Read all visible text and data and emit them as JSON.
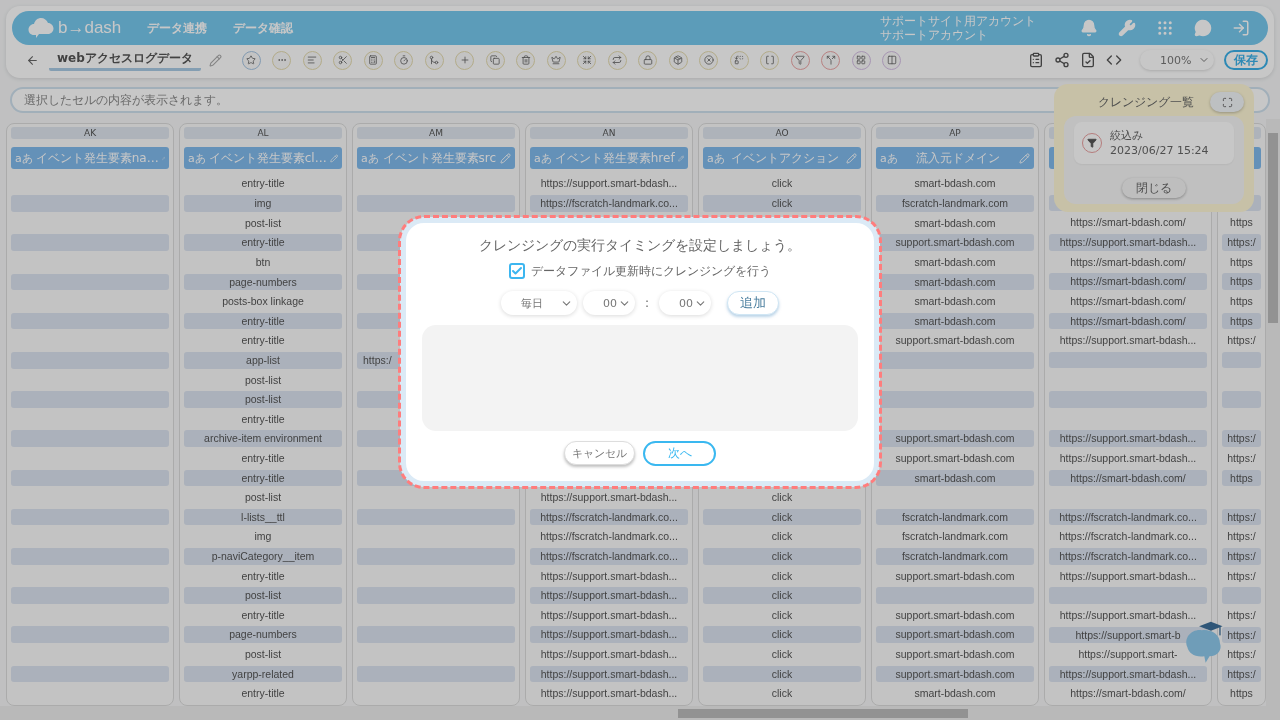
{
  "header": {
    "logo": "b→dash",
    "nav": [
      {
        "label": "データ連携"
      },
      {
        "label": "データ確認"
      }
    ],
    "account": [
      "サポートサイト用アカウント",
      "サポートアカウント"
    ]
  },
  "toolbar": {
    "title": "webアクセスログデータ",
    "zoom": "100%",
    "save": "保存"
  },
  "cell_display": {
    "placeholder": "選択したセルの内容が表示されます。"
  },
  "table": {
    "columns": [
      {
        "letter": "AK",
        "name": "イベント発生要素na…",
        "type_badge": "aあ",
        "cells": [
          null,
          null,
          null,
          null,
          null,
          null,
          null,
          null,
          null,
          null,
          null,
          null,
          null,
          null,
          null,
          null,
          null,
          null,
          null,
          null,
          null,
          null,
          null,
          null,
          null,
          null,
          null
        ]
      },
      {
        "letter": "AL",
        "name": "イベント発生要素cl…",
        "type_badge": "aあ",
        "cells": [
          "entry-title",
          "img",
          "post-list",
          "entry-title",
          "btn",
          "page-numbers",
          "posts-box linkage",
          "entry-title",
          "entry-title",
          "app-list",
          "post-list",
          "post-list",
          "entry-title",
          "archive-item environment",
          "entry-title",
          "entry-title",
          "post-list",
          "l-lists__ttl",
          "img",
          "p-naviCategory__item",
          "entry-title",
          "post-list",
          "entry-title",
          "page-numbers",
          "post-list",
          "yarpp-related",
          "entry-title"
        ]
      },
      {
        "letter": "AM",
        "name": "イベント発生要素src",
        "type_badge": "aあ",
        "kind": "url",
        "cells": [
          null,
          null,
          null,
          null,
          null,
          null,
          null,
          null,
          null,
          "https:/",
          null,
          null,
          null,
          null,
          null,
          null,
          null,
          null,
          null,
          null,
          null,
          null,
          null,
          null,
          null,
          null,
          null
        ]
      },
      {
        "letter": "AN",
        "name": "イベント発生要素href",
        "type_badge": "aあ",
        "cells": [
          "https://support.smart-bdash...",
          "https://fscratch-landmark.co...",
          null,
          null,
          null,
          null,
          null,
          null,
          null,
          null,
          null,
          null,
          null,
          null,
          null,
          null,
          "https://support.smart-bdash...",
          "https://fscratch-landmark.co...",
          "https://fscratch-landmark.co...",
          "https://fscratch-landmark.co...",
          "https://support.smart-bdash...",
          "https://support.smart-bdash...",
          "https://support.smart-bdash...",
          "https://support.smart-bdash...",
          "https://support.smart-bdash...",
          "https://support.smart-bdash...",
          "https://support.smart-bdash..."
        ]
      },
      {
        "letter": "AO",
        "name": "イベントアクション",
        "type_badge": "aあ",
        "cells": [
          "click",
          "click",
          null,
          null,
          null,
          null,
          null,
          null,
          null,
          null,
          null,
          null,
          null,
          null,
          null,
          null,
          "click",
          "click",
          "click",
          "click",
          "click",
          "click",
          "click",
          "click",
          "click",
          "click",
          "click"
        ]
      },
      {
        "letter": "AP",
        "name": "流入元ドメイン",
        "type_badge": "aあ",
        "cells": [
          "smart-bdash.com",
          "fscratch-landmark.com",
          "smart-bdash.com",
          "support.smart-bdash.com",
          "smart-bdash.com",
          "smart-bdash.com",
          "smart-bdash.com",
          "smart-bdash.com",
          "support.smart-bdash.com",
          null,
          null,
          null,
          null,
          "support.smart-bdash.com",
          "support.smart-bdash.com",
          "smart-bdash.com",
          null,
          "fscratch-landmark.com",
          "fscratch-landmark.com",
          "fscratch-landmark.com",
          "support.smart-bdash.com",
          null,
          "support.smart-bdash.com",
          "support.smart-bdash.com",
          "support.smart-bdash.com",
          "support.smart-bdash.com",
          "smart-bdash.com"
        ]
      },
      {
        "cells": [
          null,
          null,
          "https://smart-bdash.com/",
          "https://support.smart-bdash...",
          "https://smart-bdash.com/",
          "https://smart-bdash.com/",
          "https://smart-bdash.com/",
          "https://smart-bdash.com/",
          "https://support.smart-bdash...",
          null,
          null,
          null,
          null,
          "https://support.smart-bdash...",
          "https://support.smart-bdash...",
          "https://smart-bdash.com/",
          null,
          "https://fscratch-landmark.co...",
          "https://fscratch-landmark.co...",
          "https://fscratch-landmark.co...",
          "https://support.smart-bdash...",
          null,
          "https://support.smart-bdash...",
          "https://support.smart-b",
          "https://support.smart-",
          "https://support.smart-bdash...",
          "https://smart-bdash.com/"
        ],
        "kind": "text"
      },
      {
        "cells": [
          null,
          null,
          "https",
          "https:/",
          "https",
          "https",
          "https",
          "https",
          "https:/",
          null,
          null,
          null,
          null,
          "https:/",
          "https:/",
          "https",
          null,
          "https:/",
          "https:/",
          "https:/",
          "https:/",
          null,
          "https:/",
          "https:/",
          "https:/",
          "https:/",
          "https"
        ]
      }
    ]
  },
  "cleansing_panel": {
    "title": "クレンジング一覧",
    "items": [
      {
        "name": "絞込み",
        "date": "2023/06/27 15:24"
      }
    ],
    "close": "閉じる"
  },
  "dialog": {
    "title": "クレンジングの実行タイミングを設定しましょう。",
    "checkbox": {
      "label": "データファイル更新時にクレンジングを行う",
      "checked": true
    },
    "frequency": "毎日",
    "hour": "00",
    "separator": ":",
    "minute": "00",
    "add": "追加",
    "cancel": "キャンセル",
    "next": "次へ"
  }
}
